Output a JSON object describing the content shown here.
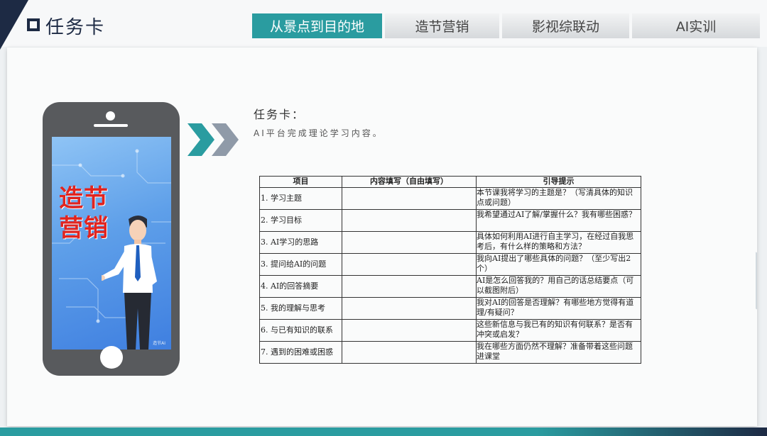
{
  "header": {
    "title": "任务卡",
    "tabs": [
      {
        "label": "从景点到目的地",
        "active": true
      },
      {
        "label": "造节营销",
        "active": false
      },
      {
        "label": "影视综联动",
        "active": false
      },
      {
        "label": "AI实训",
        "active": false
      }
    ]
  },
  "phone": {
    "promo_text": "造节营销",
    "screen_badge": "造节AI"
  },
  "task": {
    "title": "任务卡：",
    "description": "AI平台完成理论学习内容。"
  },
  "table": {
    "headers": [
      "项目",
      "内容填写（自由填写）",
      "引导提示"
    ],
    "rows": [
      {
        "item": "1. 学习主题",
        "content": "",
        "hint": "本节课我将学习的主题是？（写清具体的知识点或问题）"
      },
      {
        "item": "2. 学习目标",
        "content": "",
        "hint": "我希望通过AI了解/掌握什么？我有哪些困惑？"
      },
      {
        "item": "3. AI学习的思路",
        "content": "",
        "hint": "具体如何利用AI进行自主学习，在经过自我思考后，有什么样的策略和方法？"
      },
      {
        "item": "3. 提问给AI的问题",
        "content": "",
        "hint": "我向AI提出了哪些具体的问题？（至少写出2个）"
      },
      {
        "item": "4. AI的回答摘要",
        "content": "",
        "hint": "AI是怎么回答我的？用自己的话总结要点（可以截图附后）"
      },
      {
        "item": "5. 我的理解与思考",
        "content": "",
        "hint": "我对AI的回答是否理解？有哪些地方觉得有道理/有疑问？"
      },
      {
        "item": "6. 与已有知识的联系",
        "content": "",
        "hint": "这些新信息与我已有的知识有何联系？是否有冲突或启发？"
      },
      {
        "item": "7. 遇到的困难或困惑",
        "content": "",
        "hint": "我在哪些方面仍然不理解？准备带着这些问题进课堂"
      }
    ]
  },
  "colors": {
    "accent": "#2a9ca0",
    "navy": "#1d2a44",
    "promo_red": "#e2241f",
    "arrow_gray": "#8f9aa8"
  }
}
